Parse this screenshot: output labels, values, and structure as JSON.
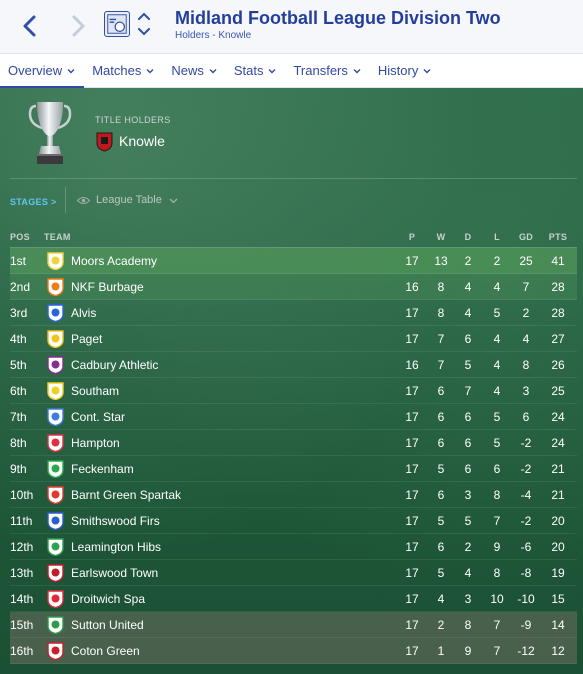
{
  "header": {
    "title": "Midland Football League Division Two",
    "subtitle": "Holders - Knowle"
  },
  "tabs": [
    {
      "label": "Overview"
    },
    {
      "label": "Matches"
    },
    {
      "label": "News"
    },
    {
      "label": "Stats"
    },
    {
      "label": "Transfers"
    },
    {
      "label": "History"
    }
  ],
  "holders": {
    "label": "TITLE HOLDERS",
    "team": "Knowle"
  },
  "stages": {
    "label": "STAGES >",
    "selected": "League Table"
  },
  "table": {
    "headers": {
      "pos": "POS",
      "team": "TEAM",
      "p": "P",
      "w": "W",
      "d": "D",
      "l": "L",
      "gd": "GD",
      "pts": "PTS"
    },
    "rows": [
      {
        "pos": "1st",
        "team": "Moors Academy",
        "p": "17",
        "w": "13",
        "d": "2",
        "l": "2",
        "gd": "25",
        "pts": "41",
        "zone": "promo",
        "color": "#f2d23a"
      },
      {
        "pos": "2nd",
        "team": "NKF Burbage",
        "p": "16",
        "w": "8",
        "d": "4",
        "l": "4",
        "gd": "7",
        "pts": "28",
        "zone": "promo2",
        "color": "#f07a18"
      },
      {
        "pos": "3rd",
        "team": "Alvis",
        "p": "17",
        "w": "8",
        "d": "4",
        "l": "5",
        "gd": "2",
        "pts": "28",
        "zone": "",
        "color": "#2a64d8"
      },
      {
        "pos": "4th",
        "team": "Paget",
        "p": "17",
        "w": "7",
        "d": "6",
        "l": "4",
        "gd": "4",
        "pts": "27",
        "zone": "",
        "color": "#f2c21e"
      },
      {
        "pos": "5th",
        "team": "Cadbury Athletic",
        "p": "16",
        "w": "7",
        "d": "5",
        "l": "4",
        "gd": "8",
        "pts": "26",
        "zone": "",
        "color": "#8a2c8c"
      },
      {
        "pos": "6th",
        "team": "Southam",
        "p": "17",
        "w": "6",
        "d": "7",
        "l": "4",
        "gd": "3",
        "pts": "25",
        "zone": "",
        "color": "#f0d020"
      },
      {
        "pos": "7th",
        "team": "Cont. Star",
        "p": "17",
        "w": "6",
        "d": "6",
        "l": "5",
        "gd": "6",
        "pts": "24",
        "zone": "",
        "color": "#3c7be0"
      },
      {
        "pos": "8th",
        "team": "Hampton",
        "p": "17",
        "w": "6",
        "d": "6",
        "l": "5",
        "gd": "-2",
        "pts": "24",
        "zone": "",
        "color": "#e03040"
      },
      {
        "pos": "9th",
        "team": "Feckenham",
        "p": "17",
        "w": "5",
        "d": "6",
        "l": "6",
        "gd": "-2",
        "pts": "21",
        "zone": "",
        "color": "#2aa84a"
      },
      {
        "pos": "10th",
        "team": "Barnt Green Spartak",
        "p": "17",
        "w": "6",
        "d": "3",
        "l": "8",
        "gd": "-4",
        "pts": "21",
        "zone": "",
        "color": "#e03a2a"
      },
      {
        "pos": "11th",
        "team": "Smithswood Firs",
        "p": "17",
        "w": "5",
        "d": "5",
        "l": "7",
        "gd": "-2",
        "pts": "20",
        "zone": "",
        "color": "#2b5fc8"
      },
      {
        "pos": "12th",
        "team": "Leamington Hibs",
        "p": "17",
        "w": "6",
        "d": "2",
        "l": "9",
        "gd": "-6",
        "pts": "20",
        "zone": "",
        "color": "#2fa052"
      },
      {
        "pos": "13th",
        "team": "Earlswood Town",
        "p": "17",
        "w": "5",
        "d": "4",
        "l": "8",
        "gd": "-8",
        "pts": "19",
        "zone": "",
        "color": "#c01f2a"
      },
      {
        "pos": "14th",
        "team": "Droitwich Spa",
        "p": "17",
        "w": "4",
        "d": "3",
        "l": "10",
        "gd": "-10",
        "pts": "15",
        "zone": "",
        "color": "#e02a3a"
      },
      {
        "pos": "15th",
        "team": "Sutton United",
        "p": "17",
        "w": "2",
        "d": "8",
        "l": "7",
        "gd": "-9",
        "pts": "14",
        "zone": "releg",
        "color": "#2e9a4a"
      },
      {
        "pos": "16th",
        "team": "Coton Green",
        "p": "17",
        "w": "1",
        "d": "9",
        "l": "7",
        "gd": "-12",
        "pts": "12",
        "zone": "releg",
        "color": "#c8202a"
      }
    ]
  }
}
